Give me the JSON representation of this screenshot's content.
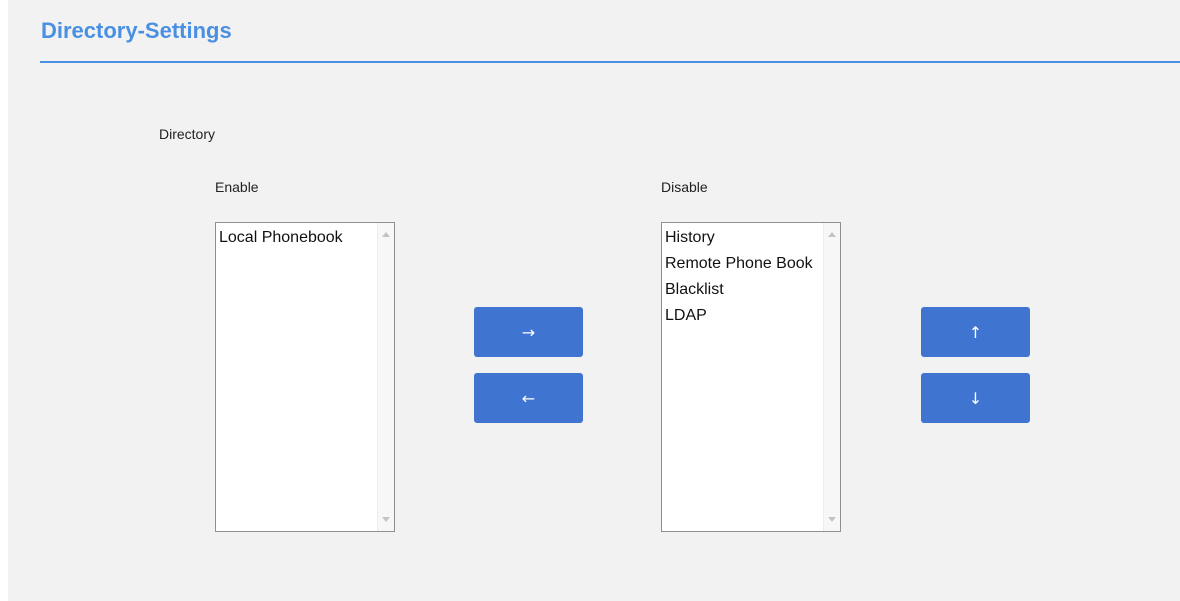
{
  "page": {
    "title": "Directory-Settings"
  },
  "section": {
    "label": "Directory"
  },
  "enable_list": {
    "label": "Enable",
    "items": [
      "Local Phonebook"
    ]
  },
  "disable_list": {
    "label": "Disable",
    "items": [
      "History",
      "Remote Phone Book",
      "Blacklist",
      "LDAP"
    ]
  },
  "buttons": {
    "move_right": "→",
    "move_left": "←",
    "move_up": "↑",
    "move_down": "↓"
  },
  "colors": {
    "accent": "#4a90e2",
    "button": "#3f74d0",
    "background": "#f2f2f2"
  }
}
